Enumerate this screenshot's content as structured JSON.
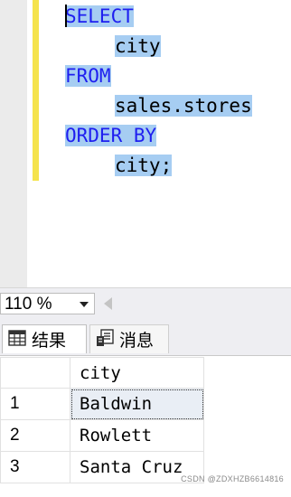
{
  "editor": {
    "lines": [
      {
        "text": "SELECT",
        "kind": "keyword",
        "indent": ""
      },
      {
        "text": "city",
        "kind": "identifier",
        "indent": "  "
      },
      {
        "text": "FROM",
        "kind": "keyword",
        "indent": ""
      },
      {
        "text": "sales.stores",
        "kind": "identifier",
        "indent": "  "
      },
      {
        "text": "ORDER BY",
        "kind": "keyword",
        "indent": ""
      },
      {
        "text": "city;",
        "kind": "identifier",
        "indent": "  "
      }
    ],
    "selection_color": "#a6cdf2",
    "keyword_color": "#1e1ef0"
  },
  "zoom": {
    "value": "110 %"
  },
  "tabs": [
    {
      "label": "结果",
      "icon": "grid-icon",
      "active": true
    },
    {
      "label": "消息",
      "icon": "messages-icon",
      "active": false
    }
  ],
  "results": {
    "columns": [
      "city"
    ],
    "rows": [
      {
        "num": "1",
        "city": "Baldwin"
      },
      {
        "num": "2",
        "city": "Rowlett"
      },
      {
        "num": "3",
        "city": "Santa Cruz"
      }
    ]
  },
  "watermark": "CSDN @ZDXHZB6614816"
}
